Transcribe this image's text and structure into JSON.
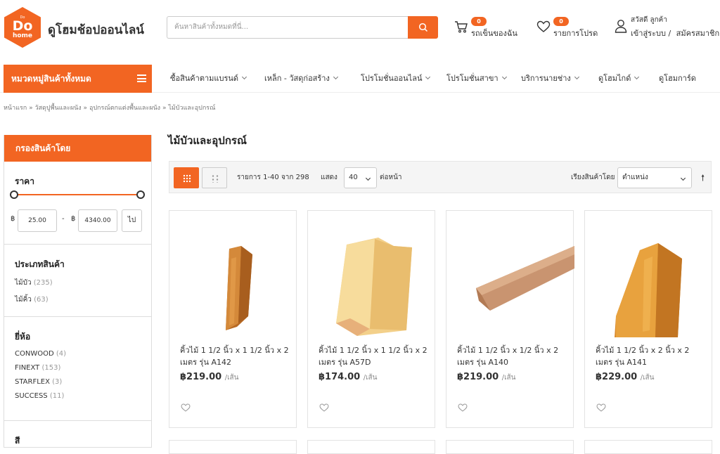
{
  "header": {
    "logo": {
      "top": "Do",
      "big": "Do",
      "bottom": "home"
    },
    "site_name": "ดูโฮมช้อปออนไลน์",
    "search_placeholder": "ค้นหาสินค้าทั้งหมดที่นี่...",
    "cart_label": "รถเข็นของฉัน",
    "cart_count": "0",
    "wishlist_label": "รายการโปรด",
    "wishlist_count": "0",
    "greeting": "สวัสดี ลูกค้า",
    "login_label": "เข้าสู่ระบบ /",
    "register_label": "สมัครสมาชิก"
  },
  "nav": {
    "all_categories": "หมวดหมู่สินค้าทั้งหมด",
    "items": [
      "ซื้อสินค้าตามแบรนด์",
      "เหล็ก - วัสดุก่อสร้าง",
      "โปรโมชั่นออนไลน์",
      "โปรโมชั่นสาขา",
      "บริการนายช่าง",
      "ดูโฮมไกด์",
      "ดูโฮมการ์ด"
    ]
  },
  "breadcrumb": [
    "หน้าแรก",
    "วัสดุปูพื้นและผนัง",
    "อุปกรณ์ตกแต่งพื้นและผนัง",
    "ไม้บัวและอุปกรณ์"
  ],
  "breadcrumb_sep": "»",
  "sidebar": {
    "filter_title": "กรองสินค้าโดย",
    "price_title": "ราคา",
    "currency": "฿",
    "price_min": "25.00",
    "price_max": "4340.00",
    "price_dash": "-",
    "go_label": "ไป",
    "type_title": "ประเภทสินค้า",
    "types": [
      {
        "label": "ไม้บัว",
        "count": "(235)"
      },
      {
        "label": "ไม้คิ้ว",
        "count": "(63)"
      }
    ],
    "brand_title": "ยี่ห้อ",
    "brands": [
      {
        "label": "CONWOOD",
        "count": "(4)"
      },
      {
        "label": "FINEXT",
        "count": "(153)"
      },
      {
        "label": "STARFLEX",
        "count": "(3)"
      },
      {
        "label": "SUCCESS",
        "count": "(11)"
      }
    ],
    "color_title": "สี"
  },
  "main": {
    "title": "ไม้บัวและอุปกรณ์",
    "items_text": "รายการ 1-40 จาก 298",
    "show_label": "แสดง",
    "per_page": "40",
    "per_page_suffix": "ต่อหน้า",
    "sort_label": "เรียงสินค้าโดย",
    "sort_value": "ตำแหน่ง",
    "sort_arrow": "🠕"
  },
  "products": [
    {
      "name": "คิ้วไม้ 1 1/2 นิ้ว x 1 1/2 นิ้ว x 2 เมตร รุ่น A142",
      "price": "฿219.00",
      "unit": "/เส้น",
      "color": "#c97a2e"
    },
    {
      "name": "คิ้วไม้ 1 1/2 นิ้ว x 1 1/2 นิ้ว x 2 เมตร รุ่น A57D",
      "price": "฿174.00",
      "unit": "/เส้น",
      "color": "#f0c878"
    },
    {
      "name": "คิ้วไม้ 1 1/2 นิ้ว x 1/2 นิ้ว x 2 เมตร รุ่น A140",
      "price": "฿219.00",
      "unit": "/เส้น",
      "color": "#c99470"
    },
    {
      "name": "คิ้วไม้ 1 1/2 นิ้ว x 2 นิ้ว x 2 เมตร รุ่น A141",
      "price": "฿229.00",
      "unit": "/เส้น",
      "color": "#d98a2c"
    }
  ],
  "colors": {
    "accent": "#f26522"
  }
}
